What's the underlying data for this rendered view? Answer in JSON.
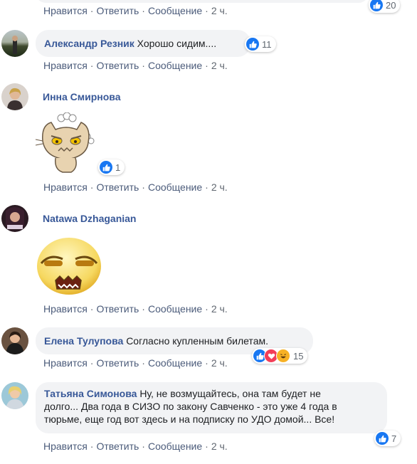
{
  "actions": {
    "like": "Нравится",
    "reply": "Ответить",
    "message": "Сообщение",
    "time": "2 ч."
  },
  "top": {
    "reaction_count": "20"
  },
  "comments": [
    {
      "author": "Александр Резник",
      "text": "Хорошо сидим....",
      "reaction_count": "11"
    },
    {
      "author": "Инна Смирнова",
      "sticker": "angry-cat-sticker",
      "reaction_count": "1"
    },
    {
      "author": "Natawa Dzhaganian",
      "sticker": "annoyed-face-sticker"
    },
    {
      "author": "Елена Тулупова",
      "text": "Согласно купленным билетам.",
      "reaction_count": "15"
    },
    {
      "author": "Татьяна Симонова",
      "text_lines": [
        "Ну, не возмущайтесь, она там будет не",
        "долго... Два года в СИЗО по закону Савченко - это уже 4 года в",
        "тюрьме, еще год вот здесь и на подписку по УДО домой... Все!"
      ],
      "reaction_count": "7"
    }
  ],
  "colors": {
    "link": "#385898",
    "like": "#1877f2",
    "love": "#f33e58",
    "haha": "#f7b125",
    "bubble": "#f2f3f5"
  }
}
